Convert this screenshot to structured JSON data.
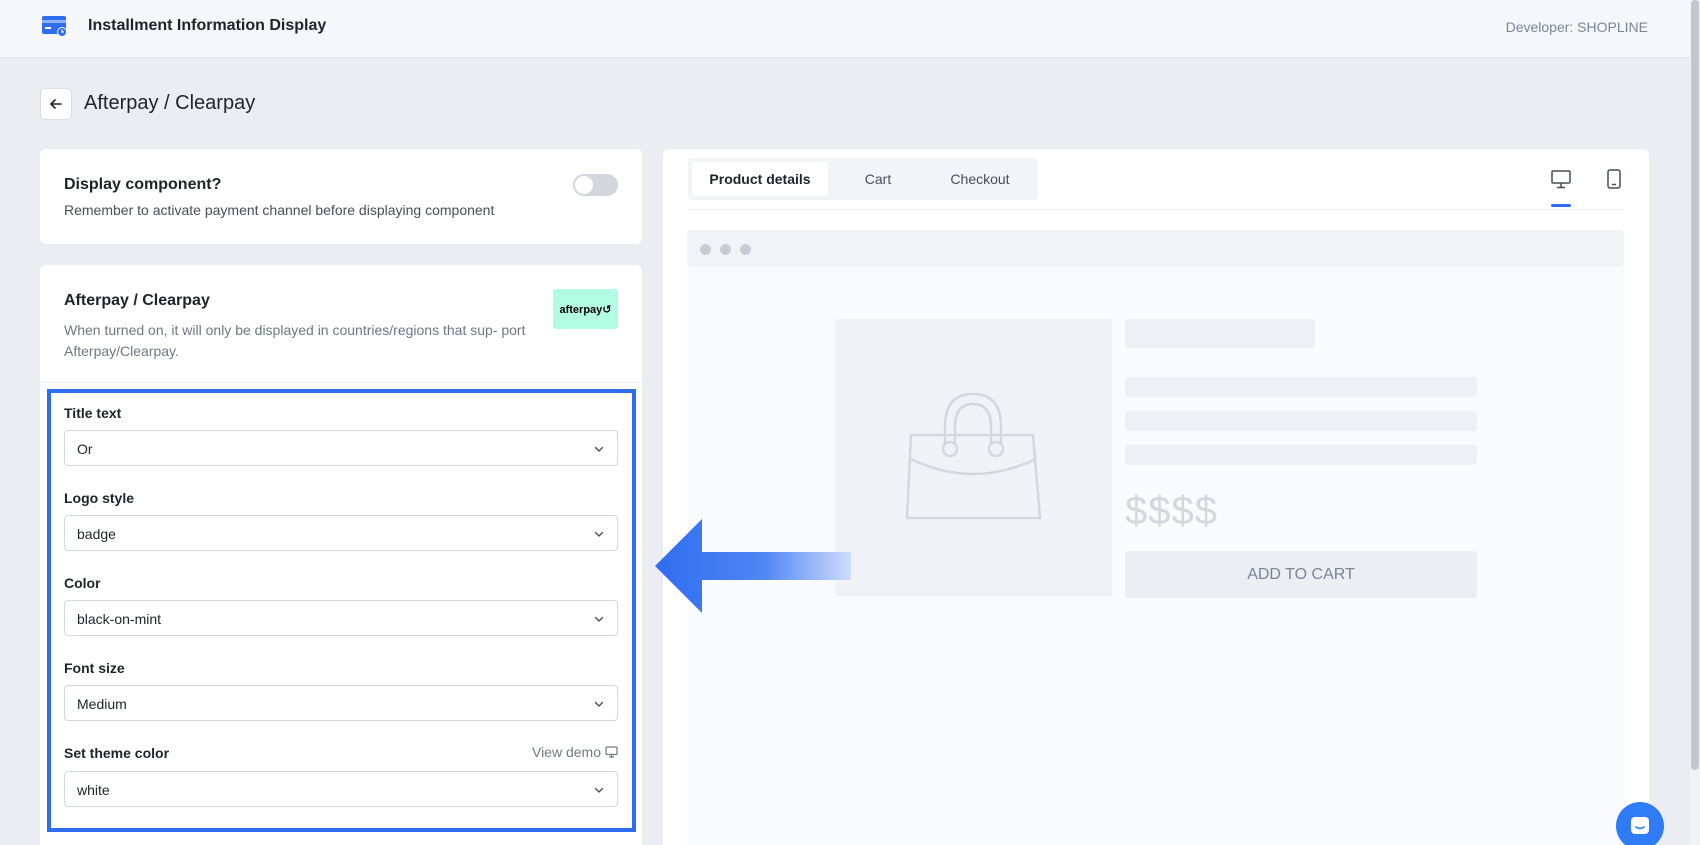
{
  "header": {
    "app_title": "Installment Information Display",
    "developer": "Developer: SHOPLINE"
  },
  "page": {
    "title": "Afterpay / Clearpay"
  },
  "display_component": {
    "title": "Display component?",
    "description": "Remember to activate payment channel before displaying component",
    "enabled": false
  },
  "settings": {
    "title": "Afterpay / Clearpay",
    "description": "When turned on, it will only be displayed in countries/regions that sup- port Afterpay/Clearpay.",
    "logo_text": "afterpay↺",
    "fields": [
      {
        "label": "Title text",
        "value": "Or"
      },
      {
        "label": "Logo style",
        "value": "badge"
      },
      {
        "label": "Color",
        "value": "black-on-mint"
      },
      {
        "label": "Font size",
        "value": "Medium"
      },
      {
        "label": "Set theme color",
        "value": "white"
      }
    ],
    "view_demo": "View demo"
  },
  "preview": {
    "tabs": [
      {
        "label": "Product details",
        "active": true
      },
      {
        "label": "Cart",
        "active": false
      },
      {
        "label": "Checkout",
        "active": false
      }
    ],
    "devices": [
      "desktop-icon",
      "mobile-icon"
    ],
    "active_device": "desktop",
    "price": "$$$$",
    "add_to_cart": "ADD TO CART"
  },
  "colors": {
    "accent": "#2f6df0",
    "mint": "#b2fce4",
    "chat": "#2f7cf6"
  }
}
